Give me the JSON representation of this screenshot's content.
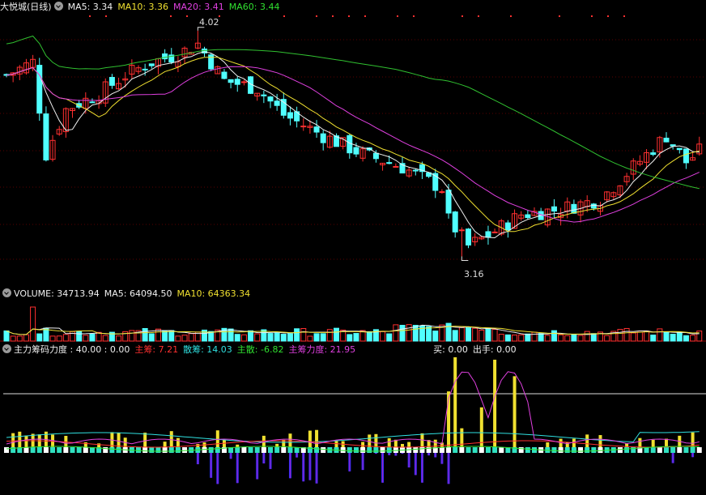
{
  "main": {
    "stock_label": "大悦城(日线)",
    "ma": [
      {
        "label": "MA5: 3.34",
        "color": "#f0f0f0"
      },
      {
        "label": "MA10: 3.36",
        "color": "#f0e030"
      },
      {
        "label": "MA20: 3.41",
        "color": "#e040e0"
      },
      {
        "label": "MA60: 3.44",
        "color": "#30e030"
      }
    ],
    "high_label": "4.02",
    "low_label": "3.16"
  },
  "volume": {
    "items": [
      {
        "label": "VOLUME: 34713.94",
        "color": "#f0f0f0"
      },
      {
        "label": "MA5: 64094.50",
        "color": "#f0f0f0"
      },
      {
        "label": "MA10: 64363.34",
        "color": "#f0e030"
      }
    ]
  },
  "indicator": {
    "items": [
      {
        "label": "主力筹码力度 : 40.00 : 0.00",
        "color": "#f0f0f0"
      },
      {
        "label": "主筹: 7.21",
        "color": "#ff3030"
      },
      {
        "label": "散筹: 14.03",
        "color": "#30e0e0"
      },
      {
        "label": "主散: -6.82",
        "color": "#30e030"
      },
      {
        "label": "主筹力度: 21.95",
        "color": "#e040e0"
      },
      {
        "label": "买: 0.00",
        "color": "#f0f0f0"
      },
      {
        "label": "出手: 0.00",
        "color": "#f0f0f0"
      }
    ]
  },
  "colors": {
    "up": "#ff3030",
    "down": "#50ffff",
    "grid": "#8b0000",
    "bg": "#000000"
  },
  "chart_data": {
    "type": "candlestick",
    "price_range": [
      3.16,
      4.02
    ],
    "x": [],
    "series": []
  }
}
